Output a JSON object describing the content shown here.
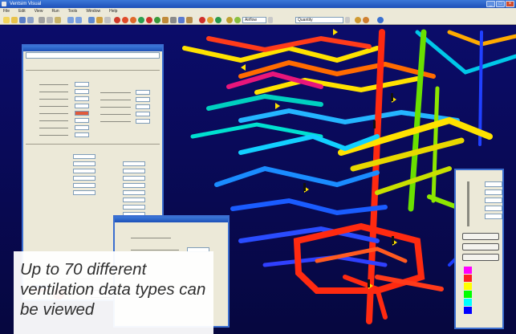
{
  "window": {
    "title": "Ventsim Visual"
  },
  "menu": {
    "items": [
      "File",
      "Edit",
      "View",
      "Run",
      "Tools",
      "Window",
      "Help"
    ]
  },
  "toolbar": {
    "dropdowns": [
      {
        "value": "Airflow"
      },
      {
        "value": "Quantity"
      }
    ]
  },
  "caption": {
    "line1": "Up to 70 different",
    "line2": "ventilation data types can",
    "line3": "be viewed"
  },
  "colors": {
    "titlebar": "#1d50b8",
    "background": "#0a0b5e",
    "panel": "#ece9d8",
    "legend": [
      "#ff00ff",
      "#ff2020",
      "#ffff00",
      "#00ff00",
      "#00ffff",
      "#0000ff"
    ]
  }
}
